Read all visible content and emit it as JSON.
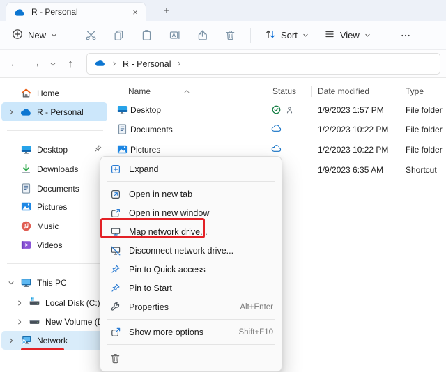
{
  "colors": {
    "accent_blue": "#0b6fd7",
    "annotation_red": "#e32126",
    "sidebar_selection": "#cce7fb",
    "titlebar_bg": "#edf1f8",
    "sync_green": "#107c41"
  },
  "icons": {
    "back": "←",
    "forward": "→",
    "up": "↑",
    "close": "×",
    "new_tab": "+",
    "onedrive": "filled blue cloud",
    "cloud_status": "blue outline cloud",
    "sync_complete": "green circled check",
    "shared_person": "gray person silhouette",
    "cut": "scissors",
    "view": "list lines",
    "more": "ellipsis dots",
    "pin": "blue pushpin",
    "delete": "trash can"
  },
  "titlebar": {
    "tab_label": "R - Personal"
  },
  "toolbar": {
    "new_label": "New",
    "sort_label": "Sort",
    "view_label": "View"
  },
  "addressbar": {
    "path": "R - Personal"
  },
  "sidebar": {
    "items": [
      {
        "label": "Home",
        "icon": "home-icon"
      },
      {
        "label": "R - Personal",
        "icon": "onedrive-icon",
        "selected": true
      },
      {
        "label": "Desktop",
        "icon": "desktop-icon",
        "pinned": true
      },
      {
        "label": "Downloads",
        "icon": "downloads-icon"
      },
      {
        "label": "Documents",
        "icon": "documents-icon"
      },
      {
        "label": "Pictures",
        "icon": "pictures-icon"
      },
      {
        "label": "Music",
        "icon": "music-icon"
      },
      {
        "label": "Videos",
        "icon": "videos-icon"
      },
      {
        "label": "This PC",
        "icon": "this-pc-icon",
        "expanded": true
      },
      {
        "label": "Local Disk (C:)",
        "icon": "local-disk-icon"
      },
      {
        "label": "New Volume (D:)",
        "icon": "disk-icon"
      },
      {
        "label": "Network",
        "icon": "network-icon",
        "selected": true,
        "red_underline": true
      }
    ]
  },
  "main": {
    "columns": [
      "Name",
      "Status",
      "Date modified",
      "Type"
    ],
    "rows": [
      {
        "name": "Desktop",
        "status": "sync-complete-icon person-icon",
        "date": "1/9/2023 1:57 PM",
        "type": "File folder"
      },
      {
        "name": "Documents",
        "status": "cloud-icon",
        "date": "1/2/2023 10:22 PM",
        "type": "File folder"
      },
      {
        "name": "Pictures",
        "status": "cloud-icon",
        "date": "1/2/2023 10:22 PM",
        "type": "File folder"
      },
      {
        "date": "1/9/2023 6:35 AM",
        "type": "Shortcut"
      }
    ]
  },
  "context_menu": {
    "items": [
      {
        "label": "Expand"
      },
      {
        "label": "Open in new tab"
      },
      {
        "label": "Open in new window"
      },
      {
        "label": "Map network drive...",
        "annotated": true
      },
      {
        "label": "Disconnect network drive..."
      },
      {
        "label": "Pin to Quick access"
      },
      {
        "label": "Pin to Start"
      },
      {
        "label": "Properties",
        "shortcut": "Alt+Enter"
      },
      {
        "label": "Show more options",
        "shortcut": "Shift+F10"
      }
    ]
  }
}
